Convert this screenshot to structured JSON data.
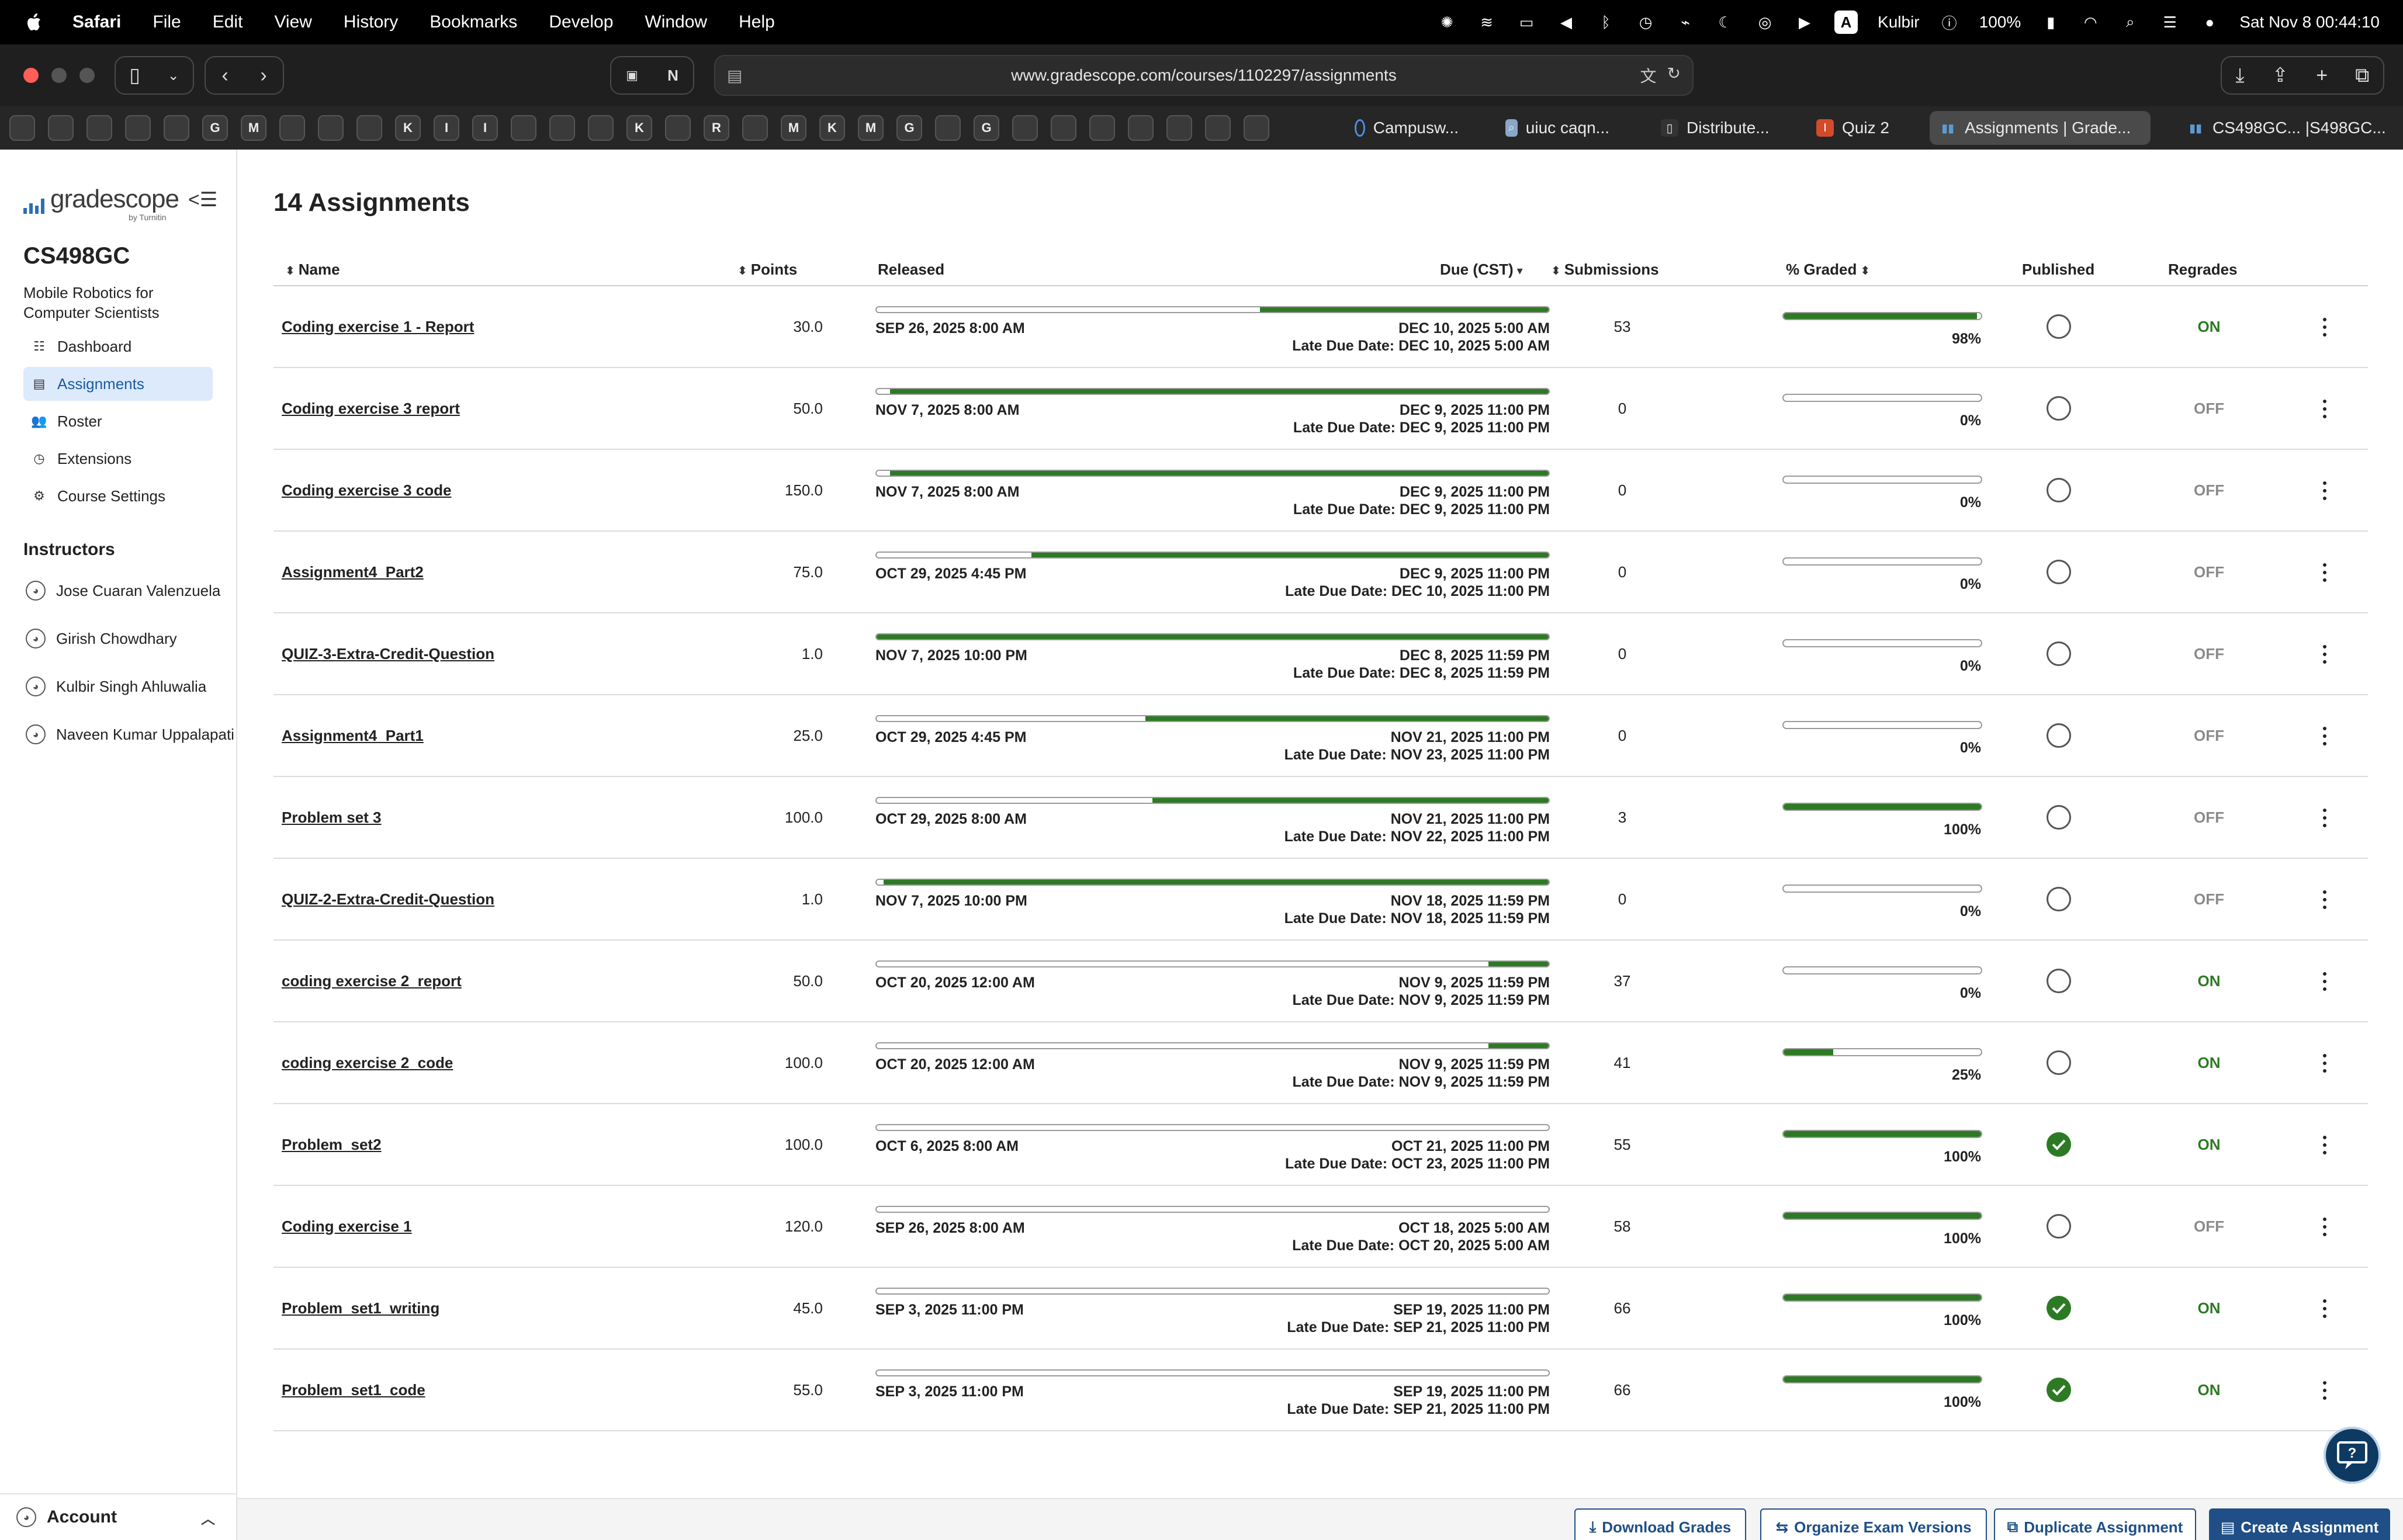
{
  "menubar": {
    "app_name": "Safari",
    "items": [
      "File",
      "Edit",
      "View",
      "History",
      "Bookmarks",
      "Develop",
      "Window",
      "Help"
    ],
    "user": "Kulbir",
    "battery": "100%",
    "datetime": "Sat Nov 8  00:44:10",
    "input_badge": "A"
  },
  "browser": {
    "url": "www.gradescope.com/courses/1102297/assignments",
    "bookmark_letters": [
      "",
      "",
      "",
      "",
      "",
      "G",
      "M",
      "",
      "",
      "",
      "K",
      "I",
      "I",
      "",
      "",
      "",
      "K",
      "",
      "R",
      "",
      "M",
      "K",
      "M",
      "G",
      "",
      "G",
      "",
      "",
      "",
      "",
      "",
      "",
      ""
    ],
    "tabs": [
      {
        "label": "Campusw...",
        "active": false
      },
      {
        "label": "uiuc caqn...",
        "active": false
      },
      {
        "label": "Distribute...",
        "active": false
      },
      {
        "label": "Quiz 2",
        "active": false
      },
      {
        "label": "Assignments | Grade...",
        "active": true
      },
      {
        "label": "CS498GC... |S498GC...",
        "active": false
      }
    ]
  },
  "sidebar": {
    "logo_text": "gradescope",
    "logo_sub": "by Turnitin",
    "course_code": "CS498GC",
    "course_name": "Mobile Robotics for Computer Scientists",
    "nav": [
      {
        "label": "Dashboard",
        "icon": "dashboard-icon",
        "active": false
      },
      {
        "label": "Assignments",
        "icon": "assignments-icon",
        "active": true
      },
      {
        "label": "Roster",
        "icon": "roster-icon",
        "active": false
      },
      {
        "label": "Extensions",
        "icon": "extensions-icon",
        "active": false
      },
      {
        "label": "Course Settings",
        "icon": "settings-icon",
        "active": false
      }
    ],
    "instructors_heading": "Instructors",
    "instructors": [
      "Jose Cuaran Valenzuela",
      "Girish Chowdhary",
      "Kulbir Singh Ahluwalia",
      "Naveen Kumar Uppalapati"
    ],
    "account_label": "Account"
  },
  "main": {
    "title": "14 Assignments",
    "columns": {
      "name": "Name",
      "points": "Points",
      "released": "Released",
      "due": "Due (CST)",
      "submissions": "Submissions",
      "graded": "% Graded",
      "published": "Published",
      "regrades": "Regrades"
    },
    "assignments": [
      {
        "name": "Coding exercise 1 - Report",
        "points": "30.0",
        "released": "SEP 26, 2025 8:00 AM",
        "due": "DEC 10, 2025 5:00 AM",
        "late_due": "Late Due Date: DEC 10, 2025 5:00 AM",
        "timeline_elapsed": 0.57,
        "submissions": "53",
        "graded_pct": "98%",
        "graded_fraction": 0.98,
        "published": false,
        "regrades": "ON"
      },
      {
        "name": "Coding exercise 3 report",
        "points": "50.0",
        "released": "NOV 7, 2025 8:00 AM",
        "due": "DEC 9, 2025 11:00 PM",
        "late_due": "Late Due Date: DEC 9, 2025 11:00 PM",
        "timeline_elapsed": 0.02,
        "submissions": "0",
        "graded_pct": "0%",
        "graded_fraction": 0,
        "published": false,
        "regrades": "OFF"
      },
      {
        "name": "Coding exercise 3 code",
        "points": "150.0",
        "released": "NOV 7, 2025 8:00 AM",
        "due": "DEC 9, 2025 11:00 PM",
        "late_due": "Late Due Date: DEC 9, 2025 11:00 PM",
        "timeline_elapsed": 0.02,
        "submissions": "0",
        "graded_pct": "0%",
        "graded_fraction": 0,
        "published": false,
        "regrades": "OFF"
      },
      {
        "name": "Assignment4_Part2",
        "points": "75.0",
        "released": "OCT 29, 2025 4:45 PM",
        "due": "DEC 9, 2025 11:00 PM",
        "late_due": "Late Due Date: DEC 10, 2025 11:00 PM",
        "timeline_elapsed": 0.23,
        "submissions": "0",
        "graded_pct": "0%",
        "graded_fraction": 0,
        "published": false,
        "regrades": "OFF"
      },
      {
        "name": "QUIZ-3-Extra-Credit-Question",
        "points": "1.0",
        "released": "NOV 7, 2025 10:00 PM",
        "due": "DEC 8, 2025 11:59 PM",
        "late_due": "Late Due Date: DEC 8, 2025 11:59 PM",
        "timeline_elapsed": 0.0,
        "submissions": "0",
        "graded_pct": "0%",
        "graded_fraction": 0,
        "published": false,
        "regrades": "OFF"
      },
      {
        "name": "Assignment4_Part1",
        "points": "25.0",
        "released": "OCT 29, 2025 4:45 PM",
        "due": "NOV 21, 2025 11:00 PM",
        "late_due": "Late Due Date: NOV 23, 2025 11:00 PM",
        "timeline_elapsed": 0.4,
        "submissions": "0",
        "graded_pct": "0%",
        "graded_fraction": 0,
        "published": false,
        "regrades": "OFF"
      },
      {
        "name": "Problem set 3",
        "points": "100.0",
        "released": "OCT 29, 2025 8:00 AM",
        "due": "NOV 21, 2025 11:00 PM",
        "late_due": "Late Due Date: NOV 22, 2025 11:00 PM",
        "timeline_elapsed": 0.41,
        "submissions": "3",
        "graded_pct": "100%",
        "graded_fraction": 1,
        "published": false,
        "regrades": "OFF"
      },
      {
        "name": "QUIZ-2-Extra-Credit-Question",
        "points": "1.0",
        "released": "NOV 7, 2025 10:00 PM",
        "due": "NOV 18, 2025 11:59 PM",
        "late_due": "Late Due Date: NOV 18, 2025 11:59 PM",
        "timeline_elapsed": 0.01,
        "submissions": "0",
        "graded_pct": "0%",
        "graded_fraction": 0,
        "published": false,
        "regrades": "OFF"
      },
      {
        "name": "coding exercise 2_report",
        "points": "50.0",
        "released": "OCT 20, 2025 12:00 AM",
        "due": "NOV 9, 2025 11:59 PM",
        "late_due": "Late Due Date: NOV 9, 2025 11:59 PM",
        "timeline_elapsed": 0.91,
        "submissions": "37",
        "graded_pct": "0%",
        "graded_fraction": 0,
        "published": false,
        "regrades": "ON"
      },
      {
        "name": "coding exercise 2_code",
        "points": "100.0",
        "released": "OCT 20, 2025 12:00 AM",
        "due": "NOV 9, 2025 11:59 PM",
        "late_due": "Late Due Date: NOV 9, 2025 11:59 PM",
        "timeline_elapsed": 0.91,
        "submissions": "41",
        "graded_pct": "25%",
        "graded_fraction": 0.25,
        "published": false,
        "regrades": "ON"
      },
      {
        "name": "Problem_set2",
        "points": "100.0",
        "released": "OCT 6, 2025 8:00 AM",
        "due": "OCT 21, 2025 11:00 PM",
        "late_due": "Late Due Date: OCT 23, 2025 11:00 PM",
        "timeline_elapsed": 1.0,
        "submissions": "55",
        "graded_pct": "100%",
        "graded_fraction": 1,
        "published": true,
        "regrades": "ON"
      },
      {
        "name": "Coding exercise 1",
        "points": "120.0",
        "released": "SEP 26, 2025 8:00 AM",
        "due": "OCT 18, 2025 5:00 AM",
        "late_due": "Late Due Date: OCT 20, 2025 5:00 AM",
        "timeline_elapsed": 1.0,
        "submissions": "58",
        "graded_pct": "100%",
        "graded_fraction": 1,
        "published": false,
        "regrades": "OFF"
      },
      {
        "name": "Problem_set1_writing",
        "points": "45.0",
        "released": "SEP 3, 2025 11:00 PM",
        "due": "SEP 19, 2025 11:00 PM",
        "late_due": "Late Due Date: SEP 21, 2025 11:00 PM",
        "timeline_elapsed": 1.0,
        "submissions": "66",
        "graded_pct": "100%",
        "graded_fraction": 1,
        "published": true,
        "regrades": "ON"
      },
      {
        "name": "Problem_set1_code",
        "points": "55.0",
        "released": "SEP 3, 2025 11:00 PM",
        "due": "SEP 19, 2025 11:00 PM",
        "late_due": "Late Due Date: SEP 21, 2025 11:00 PM",
        "timeline_elapsed": 1.0,
        "submissions": "66",
        "graded_pct": "100%",
        "graded_fraction": 1,
        "published": true,
        "regrades": "ON"
      }
    ]
  },
  "actions": {
    "download_grades": "Download Grades",
    "organize_exam_versions": "Organize Exam Versions",
    "duplicate_assignment": "Duplicate Assignment",
    "create_assignment": "Create Assignment"
  },
  "colors": {
    "accent_green": "#2d7a24",
    "primary_blue": "#1f4f86",
    "active_nav_bg": "#dceafb"
  }
}
